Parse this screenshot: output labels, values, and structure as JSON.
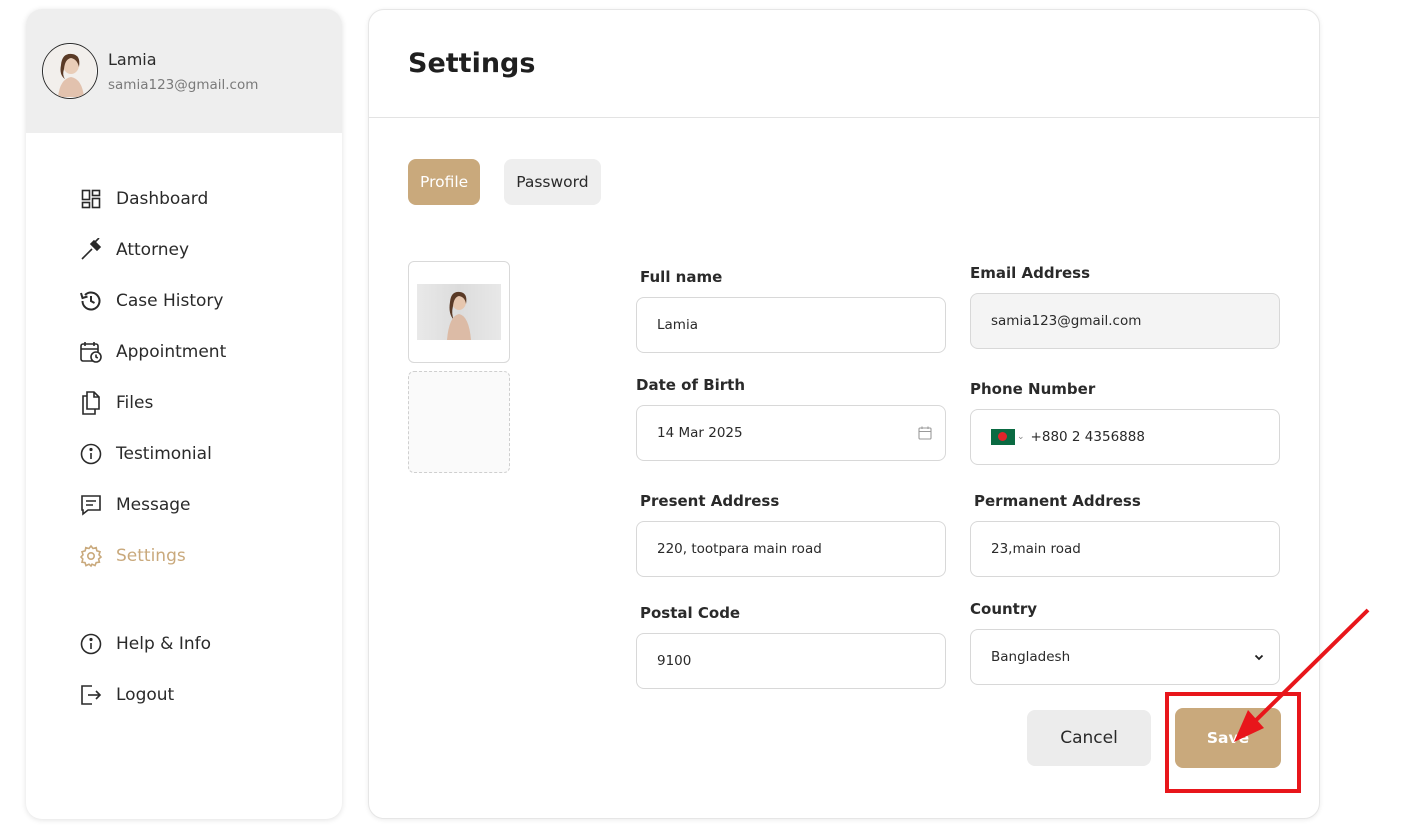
{
  "user": {
    "name": "Lamia",
    "email": "samia123@gmail.com"
  },
  "nav": {
    "items": [
      {
        "label": "Dashboard",
        "icon": "dashboard-icon"
      },
      {
        "label": "Attorney",
        "icon": "gavel-icon"
      },
      {
        "label": "Case History",
        "icon": "history-icon"
      },
      {
        "label": "Appointment",
        "icon": "calendar-clock-icon"
      },
      {
        "label": "Files",
        "icon": "files-icon"
      },
      {
        "label": "Testimonial",
        "icon": "info-icon"
      },
      {
        "label": "Message",
        "icon": "message-icon"
      },
      {
        "label": "Settings",
        "icon": "gear-icon",
        "active": true
      }
    ],
    "bottom": [
      {
        "label": "Help & Info",
        "icon": "info-icon"
      },
      {
        "label": "Logout",
        "icon": "logout-icon"
      }
    ]
  },
  "page": {
    "title": "Settings"
  },
  "tabs": {
    "profile": "Profile",
    "password": "Password"
  },
  "form": {
    "full_name": {
      "label": "Full name",
      "value": "Lamia"
    },
    "email": {
      "label": "Email Address",
      "value": "samia123@gmail.com"
    },
    "dob": {
      "label": "Date of Birth",
      "value": "14 Mar 2025"
    },
    "phone": {
      "label": "Phone Number",
      "value": "+880 2 4356888",
      "country_flag": "bangladesh-flag-icon"
    },
    "present_address": {
      "label": "Present Address",
      "value": "220, tootpara main road"
    },
    "permanent_address": {
      "label": "Permanent Address",
      "value": "23,main road"
    },
    "postal_code": {
      "label": "Postal Code",
      "value": "9100"
    },
    "country": {
      "label": "Country",
      "value": "Bangladesh"
    }
  },
  "actions": {
    "cancel": "Cancel",
    "save": "Save"
  },
  "colors": {
    "accent": "#c9a97c",
    "annotation": "#e8161b"
  }
}
